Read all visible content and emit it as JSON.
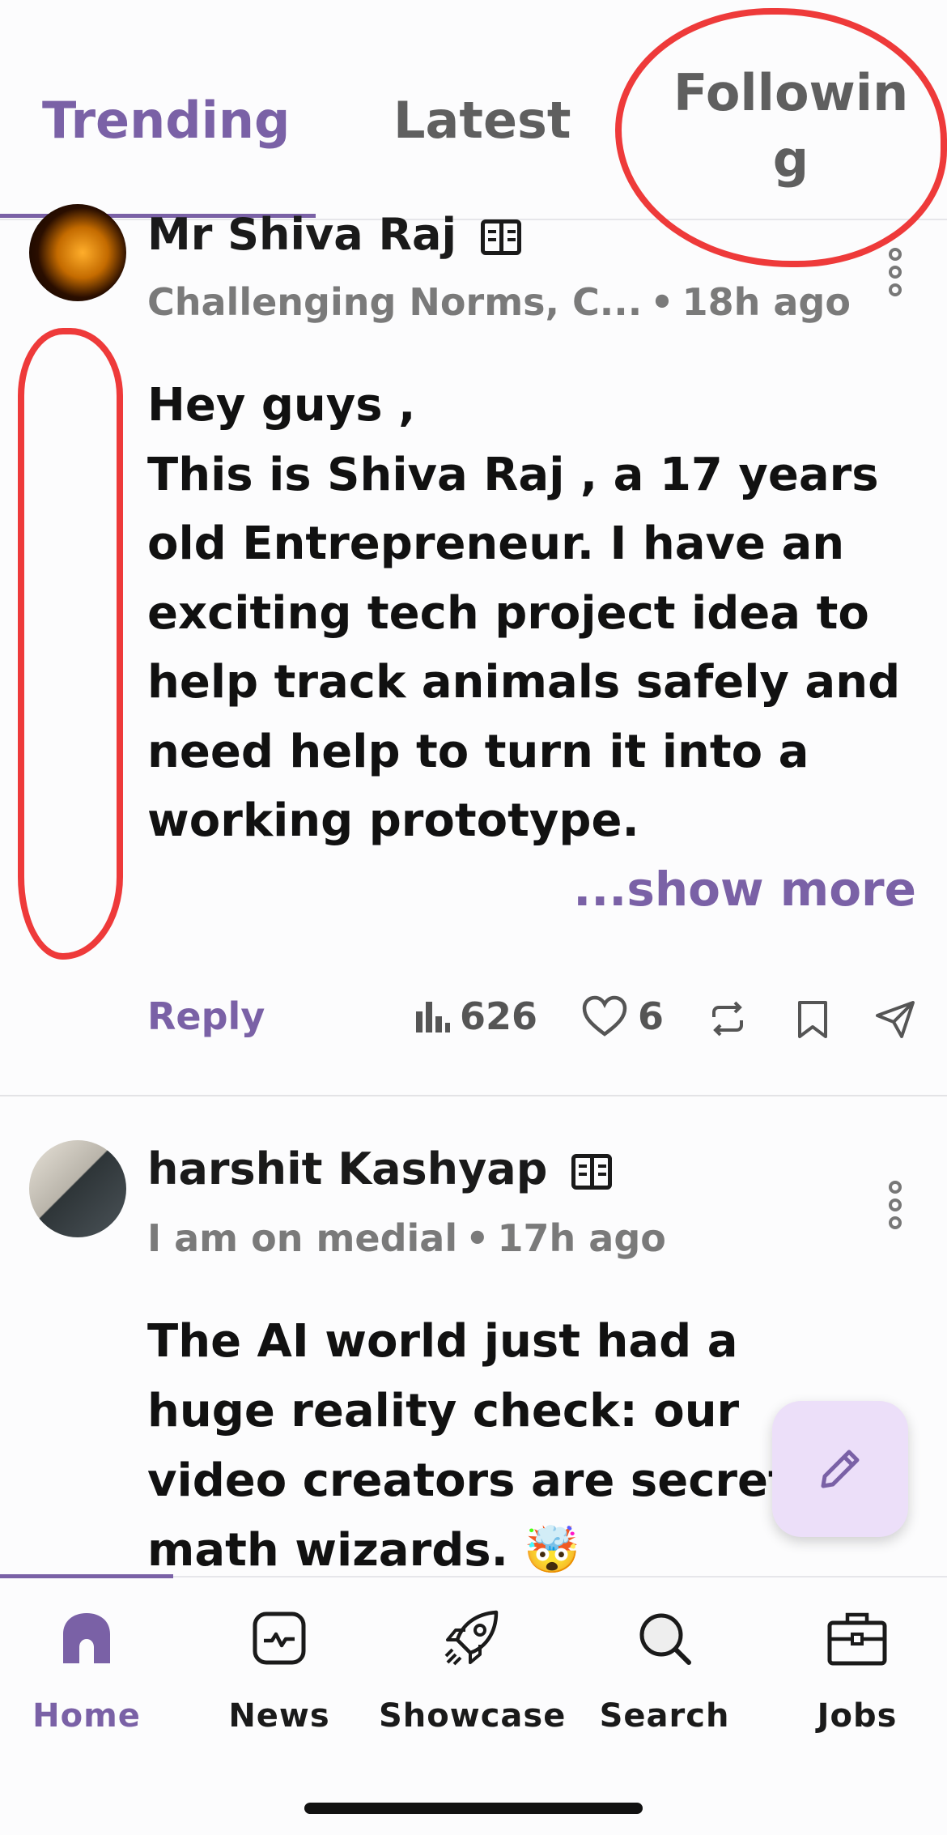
{
  "tabs": [
    {
      "label": "Trending",
      "active": true
    },
    {
      "label": "Latest",
      "active": false
    },
    {
      "label": "Following",
      "active": false
    }
  ],
  "posts": [
    {
      "author": "Mr Shiva Raj",
      "headline": "Challenging Norms, C...",
      "time": "18h ago",
      "body": "Hey guys ,\nThis is Shiva Raj , a 17 years old Entrepreneur. I have an exciting tech project idea to help track animals safely and need help to turn it into a working prototype.",
      "show_more": "...show more",
      "reply_label": "Reply",
      "views": "626",
      "likes": "6"
    },
    {
      "author": "harshit Kashyap",
      "headline": "I am on medial",
      "time": "17h ago",
      "body": "The AI world just had a huge reality check: our video creators are secret math wizards. 🤯"
    }
  ],
  "meta_separator": "•",
  "bottom_nav": [
    {
      "label": "Home",
      "icon": "home-icon",
      "active": true
    },
    {
      "label": "News",
      "icon": "news-icon",
      "active": false
    },
    {
      "label": "Showcase",
      "icon": "rocket-icon",
      "active": false
    },
    {
      "label": "Search",
      "icon": "search-icon",
      "active": false
    },
    {
      "label": "Jobs",
      "icon": "briefcase-icon",
      "active": false
    }
  ],
  "colors": {
    "accent": "#7a61a6",
    "annotation_red": "#ee3a3a",
    "fab_background": "#ecdff9"
  }
}
